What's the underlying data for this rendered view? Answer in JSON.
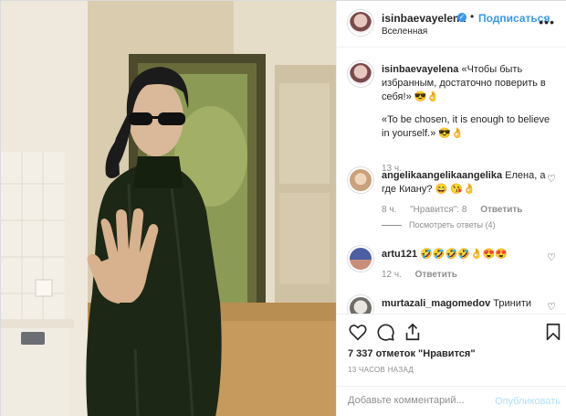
{
  "post": {
    "username": "isinbaevayelena",
    "verified_glyph": "✓",
    "follow_label": "Подписаться",
    "separator": "•",
    "location": "Вселенная",
    "more_icon": "more-horizontal-icon"
  },
  "caption": {
    "username": "isinbaevayelena",
    "text_ru": "«Чтобы быть избранным, достаточно поверить в себя!» 😎👌",
    "text_en": "«To be chosen, it is enough to believe in yourself.» 😎👌",
    "time": "13 ч."
  },
  "comments": [
    {
      "username": "angelikaangelikaangelika",
      "text": "Елена, а где Киану? 😄 😘👌",
      "time": "8 ч.",
      "likes": "\"Нравится\": 8",
      "reply": "Ответить",
      "view_replies": "Посмотреть ответы (4)"
    },
    {
      "username": "artu121",
      "text": "🤣🤣🤣🤣👌😍😍",
      "time": "12 ч.",
      "reply": "Ответить"
    },
    {
      "username": "murtazali_magomedov",
      "text": "Тринити"
    }
  ],
  "footer": {
    "likes_text": "7 337 отметок \"Нравится\"",
    "time_ago": "13 ЧАСОВ НАЗАД",
    "comment_placeholder": "Добавьте комментарий...",
    "publish_label": "Опубликовать"
  },
  "colors": {
    "accent": "#3897f0",
    "muted": "#8e8e8e",
    "text": "#262626",
    "publish_disabled": "#b2dffc"
  }
}
